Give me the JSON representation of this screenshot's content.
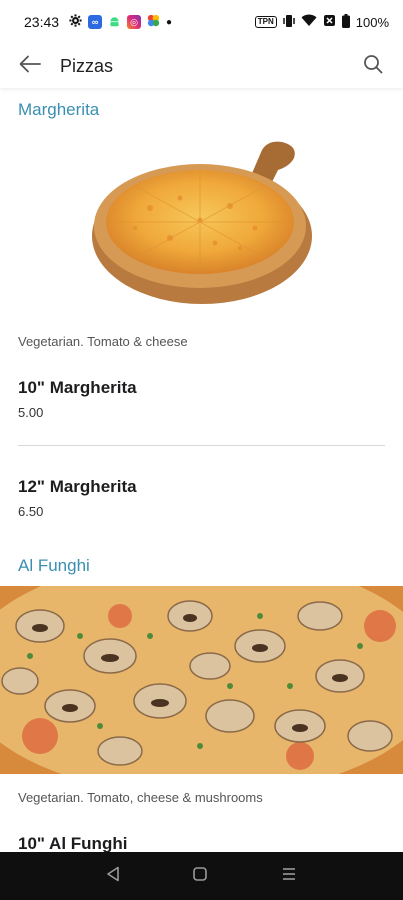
{
  "status_bar": {
    "time": "23:43",
    "battery": "100%",
    "vpn_label": "TPN",
    "notification_icons": [
      "gear-icon",
      "meta-icon",
      "android-icon",
      "instagram-icon",
      "photos-icon",
      "dot-icon"
    ]
  },
  "app_bar": {
    "title": "Pizzas",
    "back_icon": "arrow-left-icon",
    "search_icon": "search-icon"
  },
  "sections": [
    {
      "title": "Margherita",
      "description": "Vegetarian. Tomato & cheese",
      "items": [
        {
          "name": "10\" Margherita",
          "price": "5.00"
        },
        {
          "name": "12\" Margherita",
          "price": "6.50"
        }
      ]
    },
    {
      "title": "Al Funghi",
      "description": "Vegetarian. Tomato, cheese & mushrooms",
      "items": [
        {
          "name": "10\" Al Funghi",
          "price": ""
        }
      ]
    }
  ],
  "nav_bar": {
    "icons": [
      "nav-back-icon",
      "nav-home-icon",
      "nav-recents-icon"
    ]
  },
  "colors": {
    "accent": "#3a8fb0",
    "nav_bg": "#0f0f0f"
  }
}
